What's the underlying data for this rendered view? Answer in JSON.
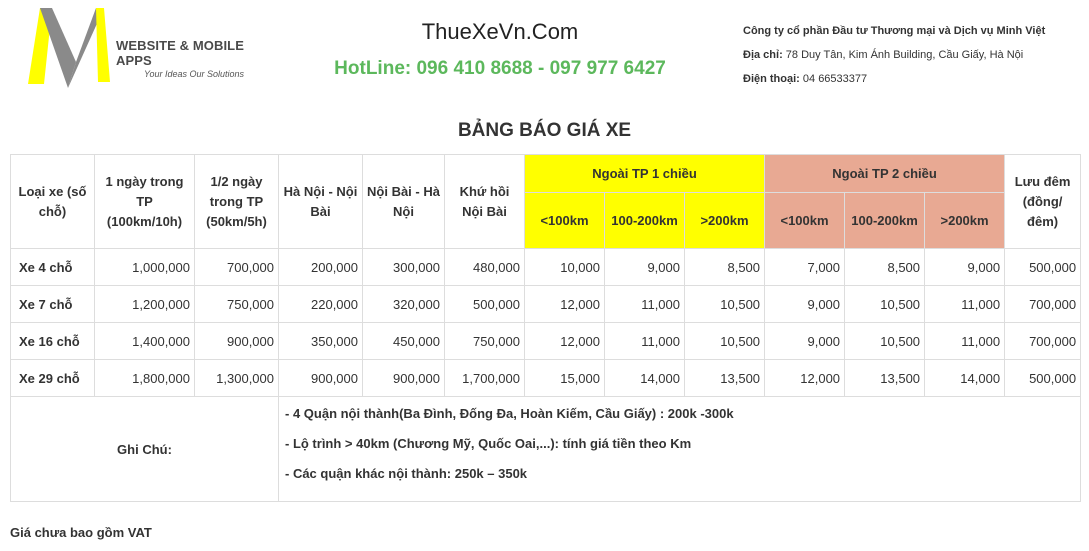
{
  "brand": {
    "name": "WEBSITE & MOBILE APPS",
    "tagline": "Your Ideas Our Solutions"
  },
  "header": {
    "site": "ThueXeVn.Com",
    "hotline": "HotLine: 096 410 8688 - 097 977 6427",
    "company": "Công ty cổ phần Đầu tư Thương mại và Dịch vụ Minh Việt",
    "address_label": "Địa chỉ:",
    "address": " 78 Duy Tân, Kim Ánh Building, Cầu Giấy, Hà Nội",
    "phone_label": "Điện thoại:",
    "phone": " 04 66533377"
  },
  "title": "BẢNG BÁO GIÁ XE",
  "table": {
    "headers": {
      "car_type": "Loại xe (số chỗ)",
      "day": "1 ngày trong TP (100km/10h)",
      "halfday": "1/2 ngày trong TP (50km/5h)",
      "hn_nb": "Hà Nội - Nội Bài",
      "nb_hn": "Nội Bài - Hà Nội",
      "round": "Khứ hồi Nội Bài",
      "out1": "Ngoài TP 1 chiều",
      "out2": "Ngoài TP 2 chiều",
      "overnight": "Lưu đêm (đồng/ đêm)",
      "lt100": "<100km",
      "r100_200": "100-200km",
      "gt200": ">200km"
    },
    "rows": [
      {
        "type": "Xe 4 chỗ",
        "day": "1,000,000",
        "half": "700,000",
        "hn_nb": "200,000",
        "nb_hn": "300,000",
        "round": "480,000",
        "o1a": "10,000",
        "o1b": "9,000",
        "o1c": "8,500",
        "o2a": "7,000",
        "o2b": "8,500",
        "o2c": "9,000",
        "night": "500,000"
      },
      {
        "type": "Xe 7 chỗ",
        "day": "1,200,000",
        "half": "750,000",
        "hn_nb": "220,000",
        "nb_hn": "320,000",
        "round": "500,000",
        "o1a": "12,000",
        "o1b": "11,000",
        "o1c": "10,500",
        "o2a": "9,000",
        "o2b": "10,500",
        "o2c": "11,000",
        "night": "700,000"
      },
      {
        "type": "Xe 16 chỗ",
        "day": "1,400,000",
        "half": "900,000",
        "hn_nb": "350,000",
        "nb_hn": "450,000",
        "round": "750,000",
        "o1a": "12,000",
        "o1b": "11,000",
        "o1c": "10,500",
        "o2a": "9,000",
        "o2b": "10,500",
        "o2c": "11,000",
        "night": "700,000"
      },
      {
        "type": "Xe 29 chỗ",
        "day": "1,800,000",
        "half": "1,300,000",
        "hn_nb": "900,000",
        "nb_hn": "900,000",
        "round": "1,700,000",
        "o1a": "15,000",
        "o1b": "14,000",
        "o1c": "13,500",
        "o2a": "12,000",
        "o2b": "13,500",
        "o2c": "14,000",
        "night": "500,000"
      }
    ],
    "note_label": "Ghi Chú:",
    "notes": [
      "- 4 Quận nội thành(Ba Đình, Đống Đa, Hoàn Kiếm, Cầu Giấy) : 200k -300k",
      "- Lộ trình > 40km (Chương Mỹ, Quốc Oai,...): tính giá tiền theo Km",
      "- Các quận khác nội thành: 250k – 350k"
    ]
  },
  "footer": "Giá chưa bao gồm VAT",
  "colors": {
    "hotline": "#5cb85c",
    "yellow": "#ffff00",
    "salmon": "#e8a993",
    "logo_yellow": "#ffff00",
    "logo_gray": "#8a8a8a"
  }
}
